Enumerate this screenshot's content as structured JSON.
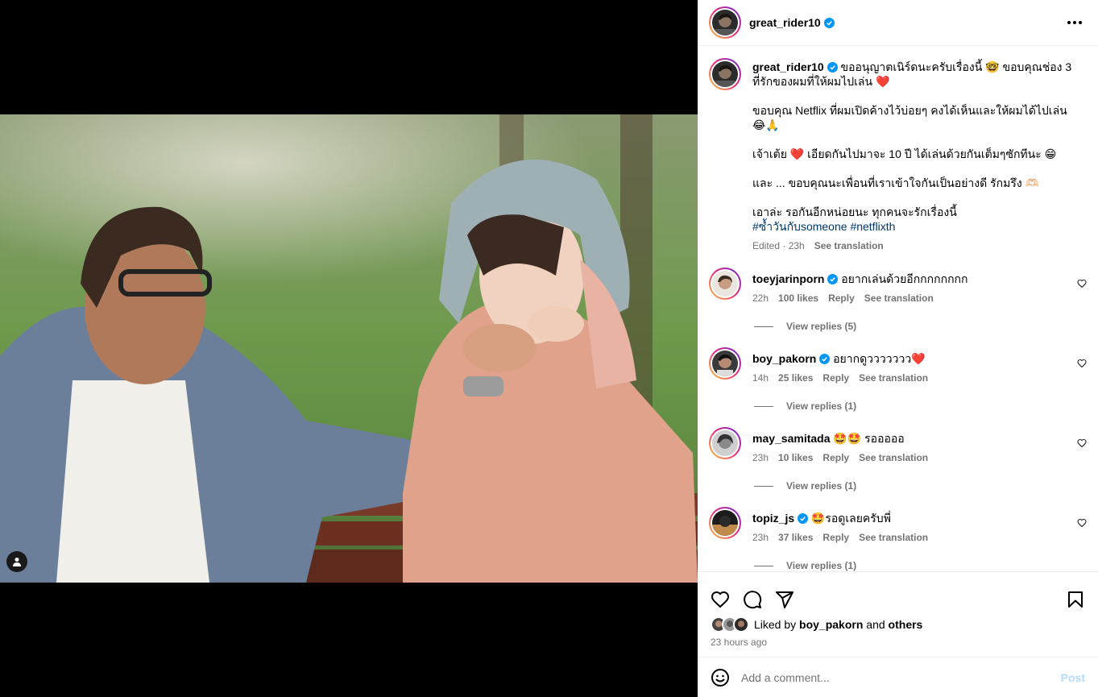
{
  "post": {
    "author": "great_rider10",
    "caption_lines": [
      "ขออนุญาตเนิร์ดนะครับเรื่องนี้ 🤓 ขอบคุณช่อง 3 ที่รักของผมที่ให้ผมไปเล่น ❤️",
      "ขอบคุณ Netflix ที่ผมเปิดค้างไว้บ่อยๆ คงได้เห็นและให้ผมได้ไปเล่น 😂🙏",
      "เจ้าเต้ย ❤️ เอียดกันไปมาจะ 10 ปี ได้เล่นด้วยกันเต็มๆซักทีนะ 😁",
      "และ ... ขอบคุณนะเพื่อนที่เราเข้าใจกันเป็นอย่างดี รักมรึง 🫶🏻",
      "เอาล่ะ รอกันอีกหน่อยนะ ทุกคนจะรักเรื่องนี้"
    ],
    "hashtags": [
      "#ซ้ำวันกับsomeone",
      "#netflixth"
    ],
    "edited": "Edited · 23h",
    "see_translation": "See translation",
    "liked_by_prefix": "Liked by",
    "liked_by_user": "boy_pakorn",
    "liked_by_and": "and",
    "liked_by_others": "others",
    "time_ago": "23 hours ago"
  },
  "comments": [
    {
      "user": "toeyjarinporn",
      "verified": true,
      "text": "อยากเล่นด้วยอีกกกกกกกก",
      "time": "22h",
      "likes": "100 likes",
      "reply": "Reply",
      "translate": "See translation",
      "replies": "View replies (5)"
    },
    {
      "user": "boy_pakorn",
      "verified": true,
      "text": "อยากดูววววววว❤️",
      "time": "14h",
      "likes": "25 likes",
      "reply": "Reply",
      "translate": "See translation",
      "replies": "View replies (1)"
    },
    {
      "user": "may_samitada",
      "verified": false,
      "text": "🤩🤩 รอออออ",
      "time": "23h",
      "likes": "10 likes",
      "reply": "Reply",
      "translate": "See translation",
      "replies": "View replies (1)"
    },
    {
      "user": "topiz_js",
      "verified": true,
      "text": "🤩รอดูเลยครับพี่",
      "time": "23h",
      "likes": "37 likes",
      "reply": "Reply",
      "translate": "See translation",
      "replies": "View replies (1)"
    }
  ],
  "comment_box": {
    "placeholder": "Add a comment...",
    "post_label": "Post"
  },
  "colors": {
    "verified": "#0095f6",
    "link": "#00376b",
    "muted": "#737373",
    "post_disabled": "#b3dbff"
  },
  "icons": [
    "more-icon",
    "heart-icon",
    "comment-icon",
    "share-icon",
    "bookmark-icon",
    "emoji-icon",
    "user-tag-icon",
    "verified-icon"
  ]
}
